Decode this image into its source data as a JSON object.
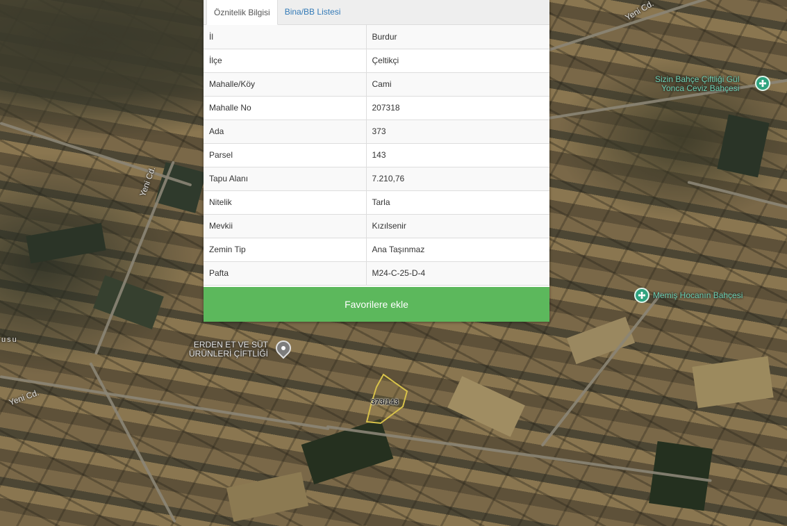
{
  "tabs": {
    "attribute_info": "Öznitelik Bilgisi",
    "building_list": "Bina/BB Listesi"
  },
  "attributes": [
    {
      "key": "İl",
      "value": "Burdur"
    },
    {
      "key": "İlçe",
      "value": "Çeltikçi"
    },
    {
      "key": "Mahalle/Köy",
      "value": "Cami"
    },
    {
      "key": "Mahalle No",
      "value": "207318"
    },
    {
      "key": "Ada",
      "value": "373"
    },
    {
      "key": "Parsel",
      "value": "143"
    },
    {
      "key": "Tapu Alanı",
      "value": "7.210,76"
    },
    {
      "key": "Nitelik",
      "value": "Tarla"
    },
    {
      "key": "Mevkii",
      "value": "Kızılsenir"
    },
    {
      "key": "Zemin Tip",
      "value": "Ana Taşınmaz"
    },
    {
      "key": "Pafta",
      "value": "M24-C-25-D-4"
    }
  ],
  "favorite_button": "Favorilere ekle",
  "map": {
    "parcel_label": "373/143",
    "road_labels": [
      "Yeni Cd.",
      "Yeni Cd.",
      "Yeni Cd."
    ],
    "area_fragment": "usu",
    "pois": {
      "poi1_line1": "Sizin Bahçe Çiftliği Gül",
      "poi1_line2": "Yonca Ceviz Bahçesi",
      "poi2": "Memiş Hocanın Bahçesi",
      "poi3_line1": "ERDEN ET VE SÜT",
      "poi3_line2": "ÜRÜNLERİ ÇİFTLİĞİ"
    },
    "parcel_outline_color": "#d8c24a",
    "poi_color": "#2fa37f",
    "button_color": "#5cb85c"
  }
}
